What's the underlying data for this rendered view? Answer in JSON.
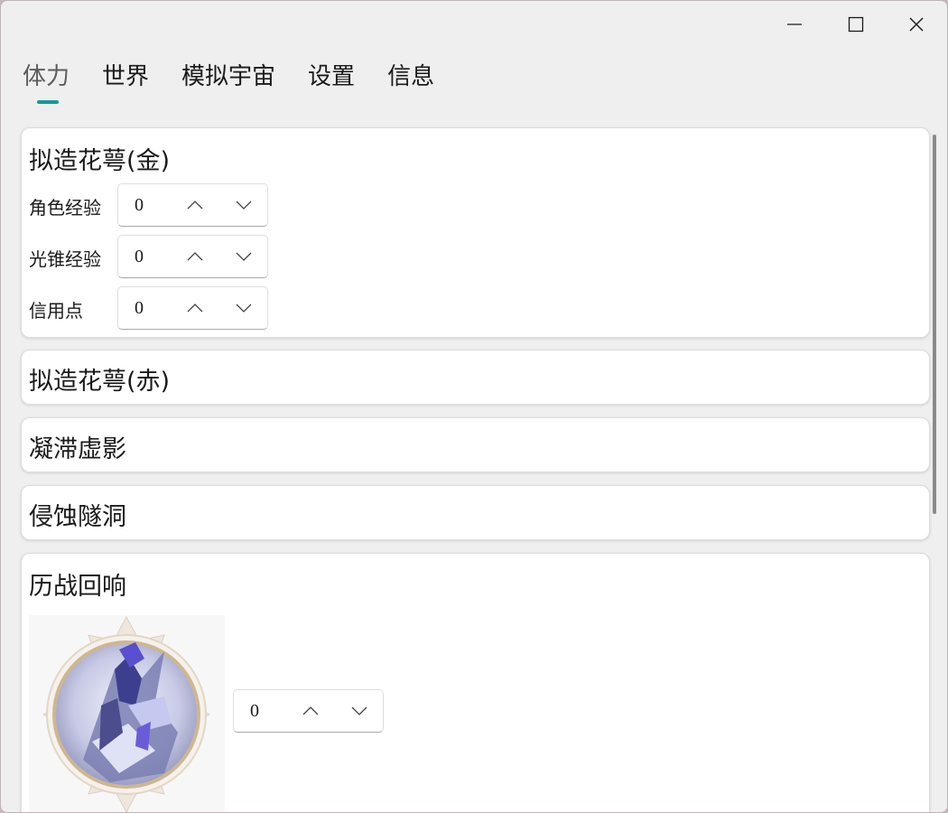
{
  "window_controls": {
    "minimize": "minimize-icon",
    "maximize": "maximize-icon",
    "close": "close-icon"
  },
  "tabs": [
    {
      "label": "体力",
      "active": true
    },
    {
      "label": "世界",
      "active": false
    },
    {
      "label": "模拟宇宙",
      "active": false
    },
    {
      "label": "设置",
      "active": false
    },
    {
      "label": "信息",
      "active": false
    }
  ],
  "colors": {
    "accent": "#129a9a",
    "window_bg": "#efefef",
    "card_bg": "#ffffff"
  },
  "cards": {
    "gold": {
      "title": "拟造花萼(金)",
      "rows": [
        {
          "label": "角色经验",
          "value": "0"
        },
        {
          "label": "光锥经验",
          "value": "0"
        },
        {
          "label": "信用点",
          "value": "0"
        }
      ]
    },
    "red": {
      "title": "拟造花萼(赤)"
    },
    "shadow": {
      "title": "凝滞虚影"
    },
    "cavern": {
      "title": "侵蚀隧洞"
    },
    "echo": {
      "title": "历战回响",
      "value": "0",
      "image": "boss-portrait"
    }
  }
}
